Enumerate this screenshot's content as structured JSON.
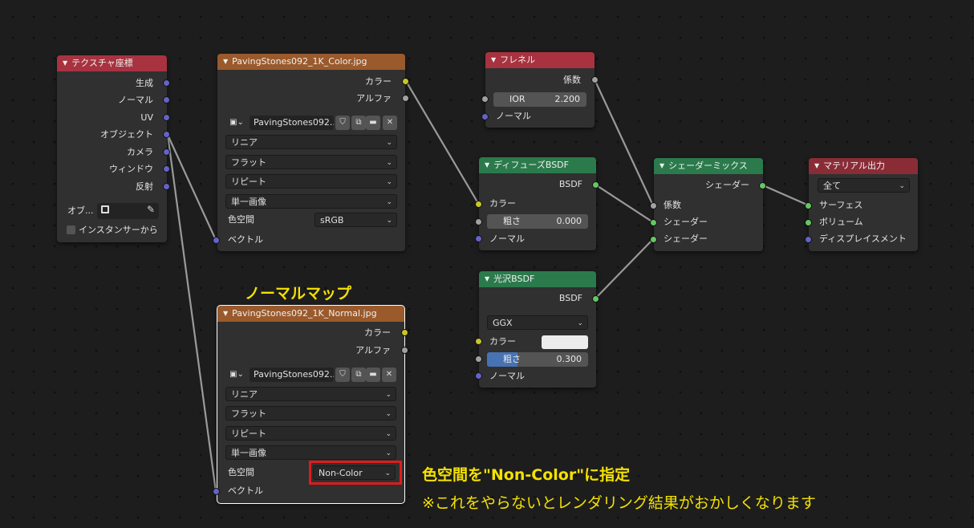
{
  "nodes": {
    "texcoord": {
      "title": "テクスチャ座標",
      "outputs": [
        "生成",
        "ノーマル",
        "UV",
        "オブジェクト",
        "カメラ",
        "ウィンドウ",
        "反射"
      ],
      "object_label": "オブ...",
      "instancer_label": "インスタンサーから"
    },
    "color_tex": {
      "title": "PavingStones092_1K_Color.jpg",
      "out_color": "カラー",
      "out_alpha": "アルファ",
      "image_name": "PavingStones092...",
      "interpolation": "リニア",
      "projection": "フラット",
      "extension": "リピート",
      "source": "単一画像",
      "colorspace_label": "色空間",
      "colorspace_value": "sRGB",
      "in_vector": "ベクトル"
    },
    "normal_tex": {
      "title": "PavingStones092_1K_Normal.jpg",
      "out_color": "カラー",
      "out_alpha": "アルファ",
      "image_name": "PavingStones092...",
      "interpolation": "リニア",
      "projection": "フラット",
      "extension": "リピート",
      "source": "単一画像",
      "colorspace_label": "色空間",
      "colorspace_value": "Non-Color",
      "in_vector": "ベクトル"
    },
    "fresnel": {
      "title": "フレネル",
      "out_fac": "係数",
      "ior_label": "IOR",
      "ior_value": "2.200",
      "in_normal": "ノーマル"
    },
    "diffuse": {
      "title": "ディフューズBSDF",
      "out_bsdf": "BSDF",
      "in_color": "カラー",
      "roughness_label": "粗さ",
      "roughness_value": "0.000",
      "in_normal": "ノーマル"
    },
    "glossy": {
      "title": "光沢BSDF",
      "out_bsdf": "BSDF",
      "distribution": "GGX",
      "in_color": "カラー",
      "roughness_label": "粗さ",
      "roughness_value": "0.300",
      "roughness_fraction": 0.3,
      "in_normal": "ノーマル"
    },
    "mix": {
      "title": "シェーダーミックス",
      "out_shader": "シェーダー",
      "in_fac": "係数",
      "in_shader1": "シェーダー",
      "in_shader2": "シェーダー"
    },
    "output": {
      "title": "マテリアル出力",
      "target": "全て",
      "in_surface": "サーフェス",
      "in_volume": "ボリューム",
      "in_displacement": "ディスプレイスメント"
    }
  },
  "annotations": {
    "normal_map_title": "ノーマルマップ",
    "colorspace_note": "色空間を\"Non-Color\"に指定",
    "warning_note": "※これをやらないとレンダリング結果がおかしくなります"
  },
  "colors": {
    "annotation": "#f4e100",
    "highlight": "#e01b1b",
    "socket_color": "#c7c729",
    "socket_float": "#a1a1a1",
    "socket_vector": "#6363c7",
    "socket_shader": "#63c763"
  },
  "icons": [
    "image-icon",
    "shield-icon",
    "duplicate-icon",
    "folder-icon",
    "close-icon",
    "eyedropper-icon",
    "object-icon"
  ]
}
